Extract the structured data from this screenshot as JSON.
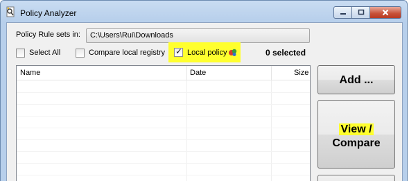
{
  "window": {
    "title": "Policy Analyzer",
    "icon": "policy-analyzer-app-icon"
  },
  "caption_buttons": {
    "minimize_icon": "minimize-icon",
    "maximize_icon": "maximize-icon",
    "close_icon": "close-icon"
  },
  "form": {
    "rule_sets_label": "Policy Rule sets in:",
    "rule_sets_path": "C:\\Users\\Rui\\Downloads"
  },
  "options": {
    "select_all": {
      "label": "Select All",
      "checked": false
    },
    "compare_local_registry": {
      "label": "Compare local registry",
      "checked": false
    },
    "local_policy": {
      "label": "Local policy",
      "checked": true,
      "icon": "group-policy-icon"
    },
    "selected_count": "0 selected"
  },
  "list": {
    "columns": [
      "Name",
      "Date",
      "Size"
    ],
    "rows": []
  },
  "buttons": {
    "add": "Add ...",
    "view_compare_line1": "View /",
    "view_compare_line2": "Compare"
  },
  "colors": {
    "highlight": "#ffff2e",
    "title_bar": "#b7cfeb",
    "close_button": "#c75137"
  }
}
